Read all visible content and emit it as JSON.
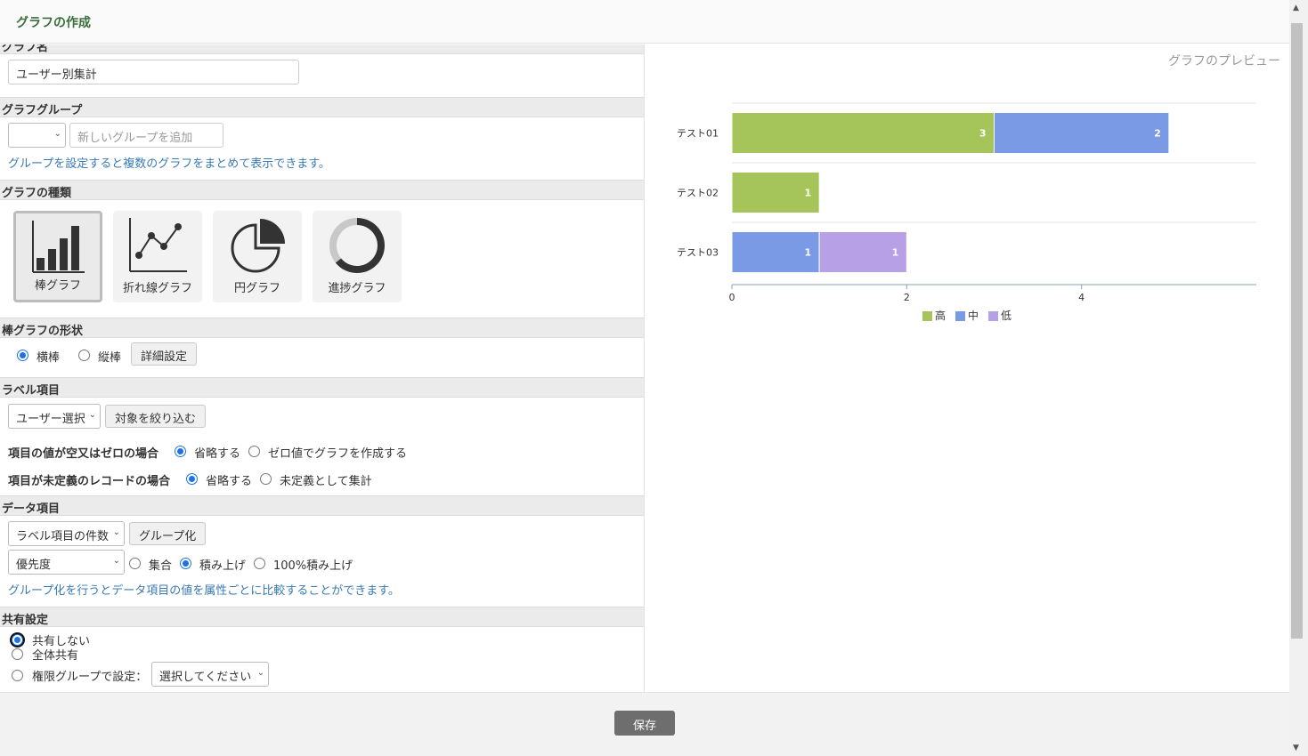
{
  "header": {
    "title": "グラフの作成"
  },
  "form": {
    "graph_name": {
      "label": "グラフ名",
      "value": "ユーザー別集計"
    },
    "graph_group": {
      "label": "グラフグループ",
      "select_value": "",
      "new_group_placeholder": "新しいグループを追加",
      "hint": "グループを設定すると複数のグラフをまとめて表示できます。"
    },
    "graph_type": {
      "label": "グラフの種類",
      "options": [
        {
          "label": "棒グラフ",
          "icon": "bar-chart-icon",
          "selected": true
        },
        {
          "label": "折れ線グラフ",
          "icon": "line-chart-icon",
          "selected": false
        },
        {
          "label": "円グラフ",
          "icon": "pie-chart-icon",
          "selected": false
        },
        {
          "label": "進捗グラフ",
          "icon": "progress-chart-icon",
          "selected": false
        }
      ]
    },
    "bar_shape": {
      "label": "棒グラフの形状",
      "horizontal": "横棒",
      "vertical": "縦棒",
      "detail_button": "詳細設定",
      "selected": "横棒"
    },
    "label_item": {
      "label": "ラベル項目",
      "select_value": "ユーザー選択",
      "filter_button": "対象を絞り込む",
      "empty_zero": {
        "label": "項目の値が空又はゼロの場合",
        "opt1": "省略する",
        "opt2": "ゼロ値でグラフを作成する",
        "selected": "省略する"
      },
      "undefined_record": {
        "label": "項目が未定義のレコードの場合",
        "opt1": "省略する",
        "opt2": "未定義として集計",
        "selected": "省略する"
      }
    },
    "data_item": {
      "label": "データ項目",
      "select_value": "ラベル項目の件数",
      "group_button": "グループ化",
      "group_select_value": "優先度",
      "mode_opt1": "集合",
      "mode_opt2": "積み上げ",
      "mode_opt3": "100%積み上げ",
      "selected_mode": "積み上げ",
      "hint": "グループ化を行うとデータ項目の値を属性ごとに比較することができます。"
    },
    "share": {
      "label": "共有設定",
      "opt1": "共有しない",
      "opt2": "全体共有",
      "opt3": "権限グループで設定：",
      "perm_select_value": "選択してください",
      "selected": "共有しない"
    }
  },
  "preview": {
    "title": "グラフのプレビュー"
  },
  "footer": {
    "save_label": "保存"
  },
  "colors": {
    "high": "#a5c55a",
    "mid": "#7b9ae6",
    "low": "#b7a0e6",
    "title_green": "#3a6e3a",
    "hint_blue": "#3a7ab5"
  },
  "chart_data": {
    "type": "bar",
    "orientation": "horizontal",
    "stacked": true,
    "categories": [
      "テスト01",
      "テスト02",
      "テスト03"
    ],
    "series": [
      {
        "name": "高",
        "color": "#a5c55a",
        "values": [
          3,
          1,
          0
        ]
      },
      {
        "name": "中",
        "color": "#7b9ae6",
        "values": [
          2,
          0,
          1
        ]
      },
      {
        "name": "低",
        "color": "#b7a0e6",
        "values": [
          0,
          0,
          1
        ]
      }
    ],
    "xticks": [
      "0",
      "2",
      "4"
    ],
    "xlim": [
      0,
      6
    ],
    "grid": true,
    "legend": "bottom-center"
  }
}
